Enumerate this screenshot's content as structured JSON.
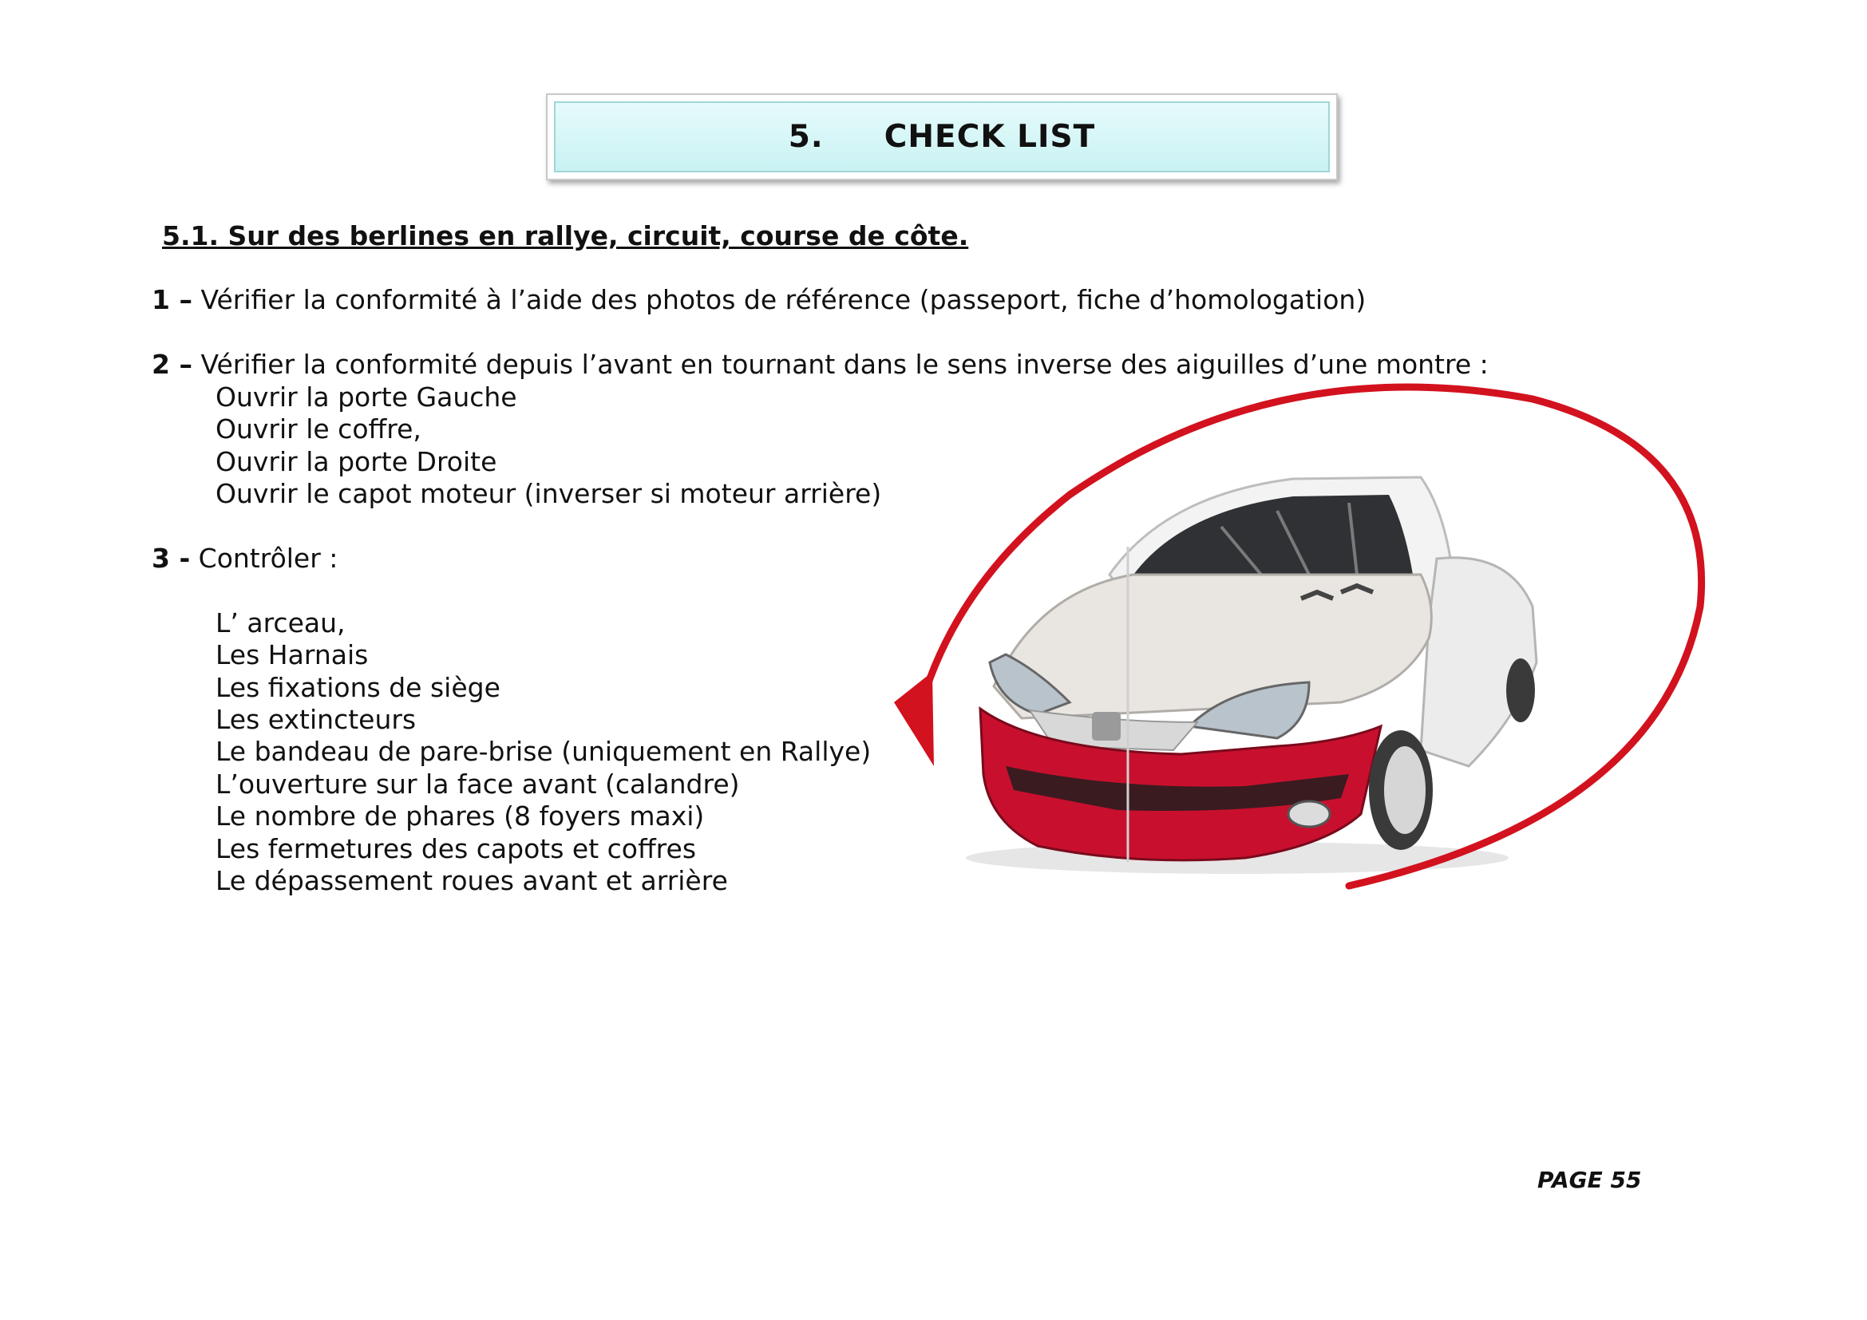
{
  "title": {
    "number": "5.",
    "text": "CHECK LIST"
  },
  "section": {
    "heading": "5.1. Sur des berlines en rallye, circuit, course de côte."
  },
  "items": [
    {
      "num": "1 –",
      "text": " Vérifier la conformité à l’aide des photos de référence (passeport, fiche d’homologation)"
    },
    {
      "num": "2 –",
      "text": " Vérifier la conformité depuis l’avant en tournant dans le sens inverse des aiguilles d’une montre :",
      "subitems": [
        "Ouvrir la porte Gauche",
        "Ouvrir le coffre,",
        "Ouvrir la porte Droite",
        "Ouvrir le capot moteur (inverser si moteur arrière)"
      ]
    },
    {
      "num": "3 -",
      "text": " Contrôler :",
      "subitems": [
        "L’ arceau,",
        "Les Harnais",
        "Les fixations de siège",
        "Les extincteurs",
        "Le bandeau de pare-brise (uniquement en Rallye)",
        "L’ouverture sur la face avant (calandre)",
        "Le nombre de phares (8 foyers maxi)",
        "Les fermetures des capots et coffres",
        "Le dépassement roues avant et arrière"
      ]
    }
  ],
  "page": {
    "label": "PAGE 55"
  },
  "colors": {
    "title_bg": "#c9f2f3",
    "arrow": "#d2121e",
    "bumper": "#c8102e"
  },
  "figure": {
    "icon": "car-rotation-arrow-icon"
  }
}
